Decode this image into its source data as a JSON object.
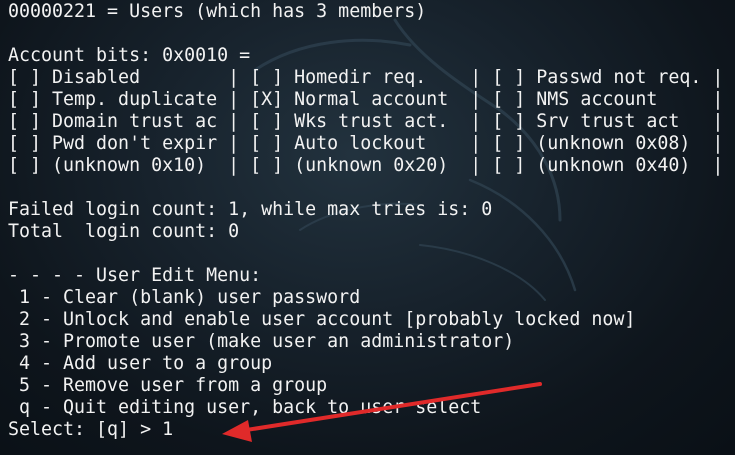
{
  "terminal": {
    "lines": [
      "00000221 = Users (which has 3 members)",
      "",
      "Account bits: 0x0010 =",
      "[ ] Disabled        | [ ] Homedir req.    | [ ] Passwd not req. |",
      "[ ] Temp. duplicate | [X] Normal account  | [ ] NMS account     |",
      "[ ] Domain trust ac | [ ] Wks trust act.  | [ ] Srv trust act   |",
      "[ ] Pwd don't expir | [ ] Auto lockout    | [ ] (unknown 0x08)  |",
      "[ ] (unknown 0x10)  | [ ] (unknown 0x20)  | [ ] (unknown 0x40)  |",
      "",
      "Failed login count: 1, while max tries is: 0",
      "Total  login count: 0",
      "",
      "- - - - User Edit Menu:",
      " 1 - Clear (blank) user password",
      " 2 - Unlock and enable user account [probably locked now]",
      " 3 - Promote user (make user an administrator)",
      " 4 - Add user to a group",
      " 5 - Remove user from a group",
      " q - Quit editing user, back to user select",
      "Select: [q] > 1"
    ]
  },
  "annotation": {
    "arrow_color": "#e02a2a"
  }
}
